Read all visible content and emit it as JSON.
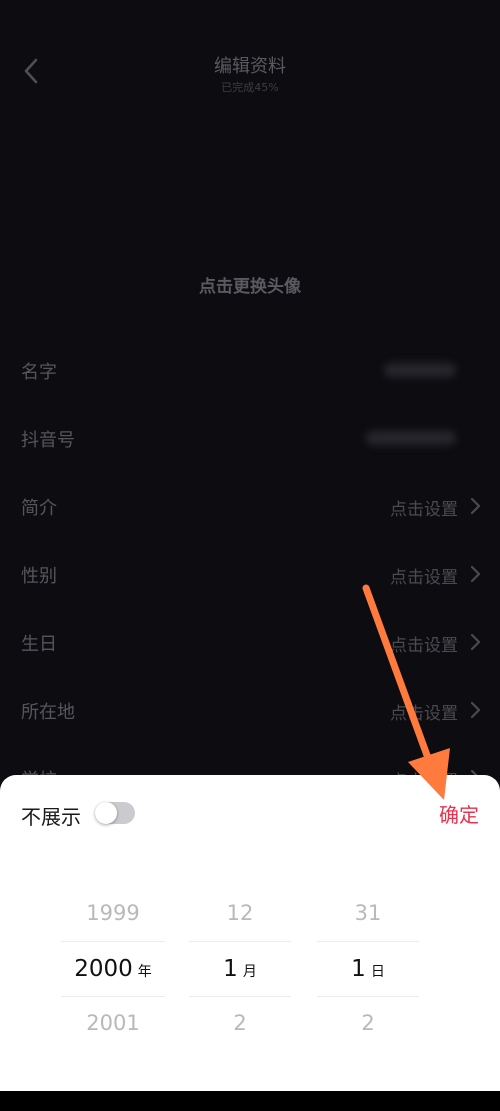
{
  "nav": {
    "title": "编辑资料",
    "subtitle": "已完成45%"
  },
  "avatar": {
    "text": "点击更换头像"
  },
  "rows": [
    {
      "label": "名字",
      "value": ""
    },
    {
      "label": "抖音号",
      "value": ""
    },
    {
      "label": "简介",
      "value": "点击设置"
    },
    {
      "label": "性别",
      "value": "点击设置"
    },
    {
      "label": "生日",
      "value": "点击设置"
    },
    {
      "label": "所在地",
      "value": "点击设置"
    },
    {
      "label": "学校",
      "value": "点击设置"
    }
  ],
  "sheet": {
    "hide_label": "不展示",
    "hide_toggle_on": false,
    "confirm_label": "确定",
    "year": {
      "prev": "1999",
      "selected": "2000",
      "next": "2001",
      "unit": "年"
    },
    "month": {
      "prev": "12",
      "selected": "1",
      "next": "2",
      "unit": "月"
    },
    "day": {
      "prev": "31",
      "selected": "1",
      "next": "2",
      "unit": "日"
    }
  },
  "colors": {
    "accent": "#e8324e",
    "annotation_arrow": "#ff7a3d",
    "background": "#0d0d11"
  },
  "icons": {
    "back": "chevron-left-icon",
    "row_chevron": "chevron-right-icon"
  }
}
